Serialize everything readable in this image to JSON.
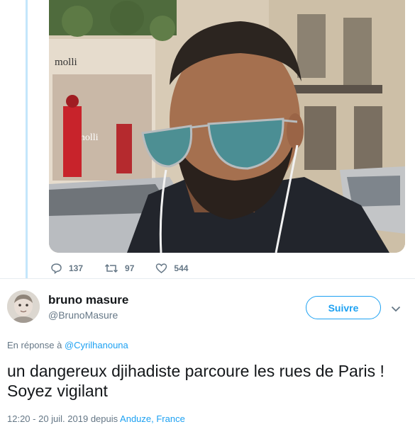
{
  "tweet_photo": {
    "storefront_sign": "molli",
    "window_sign": "molli"
  },
  "quoted_actions": {
    "reply_count": "137",
    "retweet_count": "97",
    "like_count": "544"
  },
  "author": {
    "display_name": "bruno masure",
    "handle": "@BrunoMasure",
    "follow_label": "Suivre"
  },
  "reply_context": {
    "prefix": "En réponse à",
    "mention": "@Cyrilhanouna"
  },
  "tweet": {
    "text": "un dangereux djihadiste parcoure les rues de Paris ! Soyez vigilant",
    "timestamp": "12:20 - 20 juil. 2019",
    "via": "depuis",
    "location": "Anduze, France"
  },
  "colors": {
    "accent": "#1da1f2",
    "muted_text": "#657786",
    "thread_line": "#c4e6fb"
  }
}
